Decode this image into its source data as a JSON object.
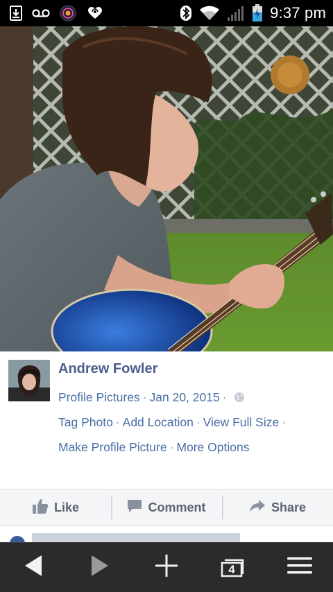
{
  "status_bar": {
    "time": "9:37 pm",
    "left_icons": [
      "download-icon",
      "voicemail-icon",
      "app-icon",
      "iheartradio-icon"
    ],
    "right_icons": [
      "bluetooth-icon",
      "wifi-icon",
      "signal-icon",
      "battery-charging-icon"
    ]
  },
  "photo": {
    "subject": "person-playing-guitar"
  },
  "post": {
    "author": "Andrew Fowler",
    "album": "Profile Pictures",
    "separator": "·",
    "date": "Jan 20, 2015",
    "privacy_icon": "globe-icon",
    "links_row1": [
      "Tag Photo",
      "Add Location",
      "View Full Size"
    ],
    "links_row2": [
      "Make Profile Picture",
      "More Options"
    ]
  },
  "actions": {
    "like": "Like",
    "comment": "Comment",
    "share": "Share"
  },
  "nav": {
    "tab_count": "4",
    "buttons": [
      "back-icon",
      "forward-icon",
      "plus-icon",
      "tabs-icon",
      "menu-icon"
    ]
  },
  "colors": {
    "status_bar": "#000000",
    "link": "#4a6ea8",
    "author": "#4a5f8c",
    "navbar": "#2b2b2d",
    "guitar_blue": "#1e4fa8"
  }
}
